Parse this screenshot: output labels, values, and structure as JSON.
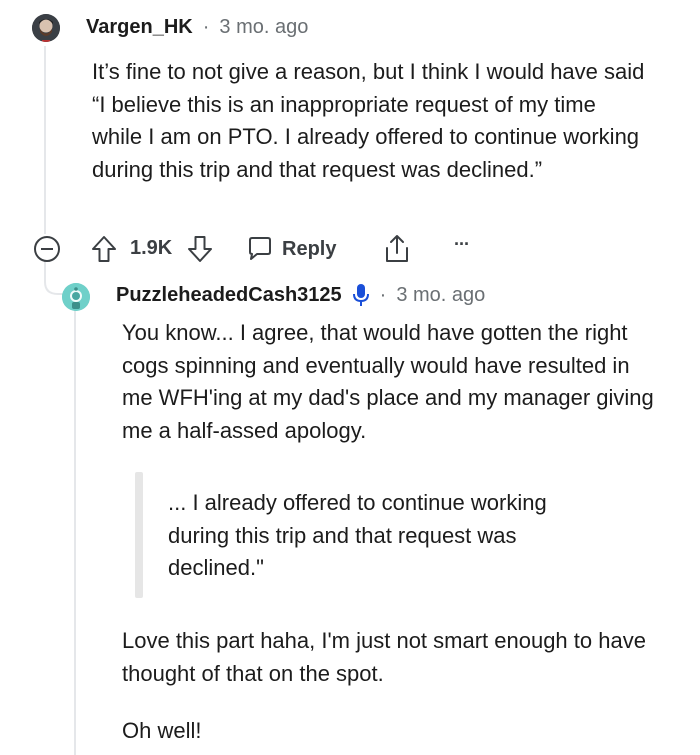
{
  "parent_comment": {
    "username": "Vargen_HK",
    "separator": "·",
    "time": "3 mo. ago",
    "body": "It’s fine to not give a reason, but I think I would have said “I believe this is an inappropriate request of my time while I am on PTO. I already offered to continue working during this trip and that request was declined.”",
    "actions": {
      "score": "1.9K",
      "reply_label": "Reply",
      "more_label": "···"
    }
  },
  "reply_comment": {
    "username": "PuzzleheadedCash3125",
    "separator": "·",
    "time": "3 mo. ago",
    "paragraph1": "You know... I agree, that would have gotten the right cogs spinning and eventually would have resulted in me WFH'ing at my dad's place and my manager giving me a half-assed apology.",
    "quote": "... I already offered to continue working during this trip and that request was declined.\"",
    "paragraph2": "Love this part haha, I'm just not smart enough to have thought of that on the spot.",
    "paragraph3": "Oh well!"
  },
  "colors": {
    "thread_line": "#e5e7ea",
    "text": "#1c1c1c",
    "meta": "#6a6f73",
    "quote_bar": "#e6e6e6",
    "mic_icon": "#1a4fd8"
  }
}
